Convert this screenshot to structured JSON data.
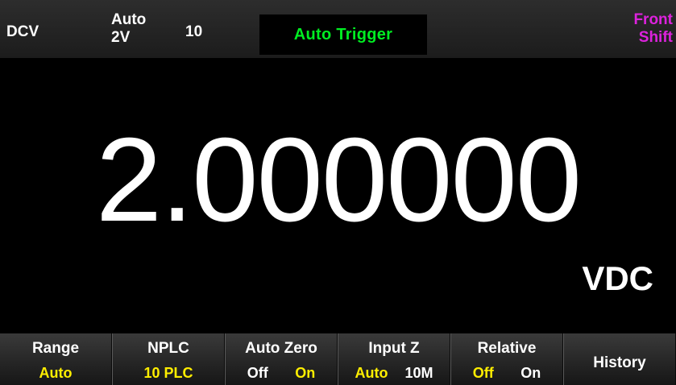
{
  "status_bar": {
    "function": "DCV",
    "range_mode": "Auto",
    "range_value": "2V",
    "samples": "10",
    "trigger": "Auto Trigger",
    "panel": "Front",
    "shift": "Shift"
  },
  "display": {
    "reading": "2.000000",
    "unit": "VDC"
  },
  "softkeys": {
    "range": {
      "title": "Range",
      "value": "Auto"
    },
    "nplc": {
      "title": "NPLC",
      "value": "10 PLC"
    },
    "auto_zero": {
      "title": "Auto Zero",
      "options": [
        "Off",
        "On"
      ],
      "selected": "On"
    },
    "input_z": {
      "title": "Input Z",
      "options": [
        "Auto",
        "10M"
      ],
      "selected": "Auto"
    },
    "relative": {
      "title": "Relative",
      "options": [
        "Off",
        "On"
      ],
      "selected": "Off"
    },
    "history": {
      "title": "History"
    }
  },
  "colors": {
    "trigger": "#00ee22",
    "front_shift": "#dd22dd",
    "highlight": "#ffee00",
    "text": "#ffffff",
    "background": "#000000"
  }
}
